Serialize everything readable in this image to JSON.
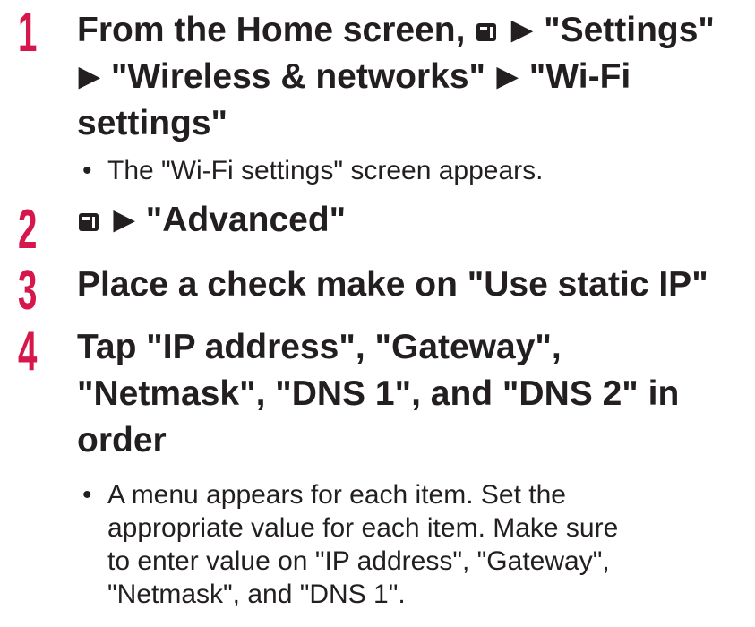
{
  "steps": [
    {
      "number": "1",
      "title_line1_prefix": "From the Home screen,",
      "title_line1_suffix": "\"Settings\"",
      "title_line2_a": "\"Wireless & networks\"",
      "title_line2_b": "\"Wi-Fi",
      "title_line3": "settings\"",
      "note": "The \"Wi-Fi settings\" screen appears."
    },
    {
      "number": "2",
      "title": "\"Advanced\""
    },
    {
      "number": "3",
      "title": "Place a check make on \"Use static IP\""
    },
    {
      "number": "4",
      "title_line1": "Tap \"IP address\", \"Gateway\",",
      "title_line2": "\"Netmask\", \"DNS 1\", and \"DNS 2\" in",
      "title_line3": "order",
      "note_line1": "A menu appears for each item. Set the",
      "note_line2": "appropriate value for each item. Make sure",
      "note_line3": "to enter value on \"IP address\", \"Gateway\",",
      "note_line4": "\"Netmask\", and \"DNS 1\"."
    }
  ],
  "symbols": {
    "arrow": "▶",
    "bullet": "•",
    "menu_icon": "menu-key-icon"
  },
  "colors": {
    "step_number": "#d6174b",
    "text": "#231f20"
  }
}
